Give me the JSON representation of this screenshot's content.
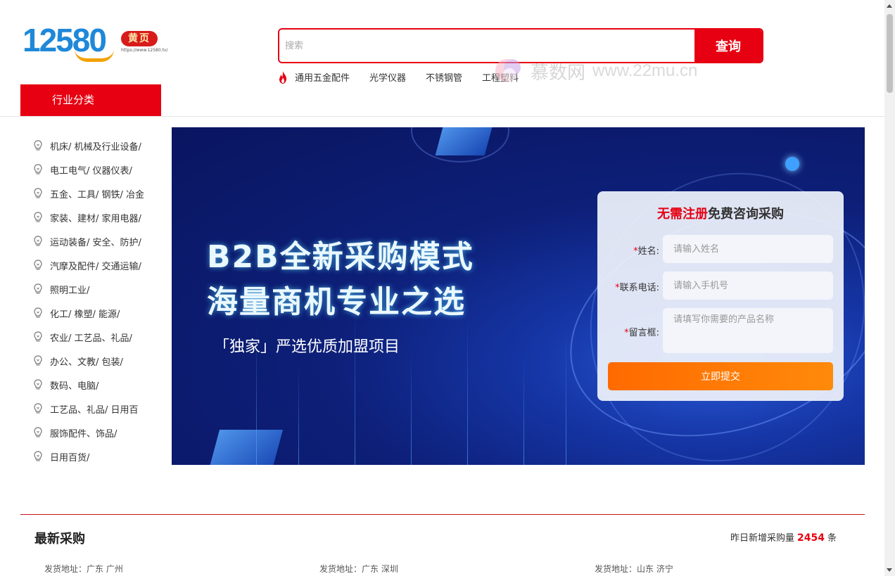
{
  "header": {
    "logo": {
      "number": "12580",
      "badge": "黄页",
      "url": "https://www.12580.tv/"
    },
    "search": {
      "placeholder": "搜索",
      "button": "查询"
    },
    "hot_links": [
      "通用五金配件",
      "光学仪器",
      "不锈钢管",
      "工程塑料"
    ],
    "watermark": {
      "text": "慕数网",
      "url": "www.22mu.cn"
    },
    "category_tab": "行业分类"
  },
  "sidebar": {
    "items": [
      "机床/ 机械及行业设备/",
      "电工电气/ 仪器仪表/",
      "五金、工具/ 钢铁/ 冶金",
      "家装、建材/ 家用电器/",
      "运动装备/ 安全、防护/",
      "汽摩及配件/ 交通运输/",
      "照明工业/",
      "化工/ 橡塑/ 能源/",
      "农业/ 工艺品、礼品/",
      "办公、文教/ 包装/",
      "数码、电脑/",
      "工艺品、礼品/ 日用百",
      "服饰配件、饰品/",
      "日用百货/"
    ]
  },
  "banner": {
    "title_line1": "B2B全新采购模式",
    "title_line2": "海量商机专业之选",
    "subtitle": "「独家」严选优质加盟项目"
  },
  "form": {
    "title_red": "无需注册",
    "title_rest": "免费咨询采购",
    "name_label": "姓名:",
    "name_placeholder": "请输入姓名",
    "phone_label": "联系电话:",
    "phone_placeholder": "请输入手机号",
    "message_label": "留言框:",
    "message_placeholder": "请填写你需要的产品名称",
    "submit": "立即提交",
    "required_mark": "*"
  },
  "latest": {
    "title": "最新采购",
    "stat_prefix": "昨日新增采购量",
    "stat_count": "2454",
    "stat_suffix": "条",
    "addresses": [
      "发货地址：广东 广州",
      "发货地址：广东 深圳",
      "发货地址：山东 济宁"
    ]
  },
  "colors": {
    "brand_red": "#e60012",
    "logo_blue": "#1e88d9",
    "submit_orange": "#ff7a00"
  }
}
